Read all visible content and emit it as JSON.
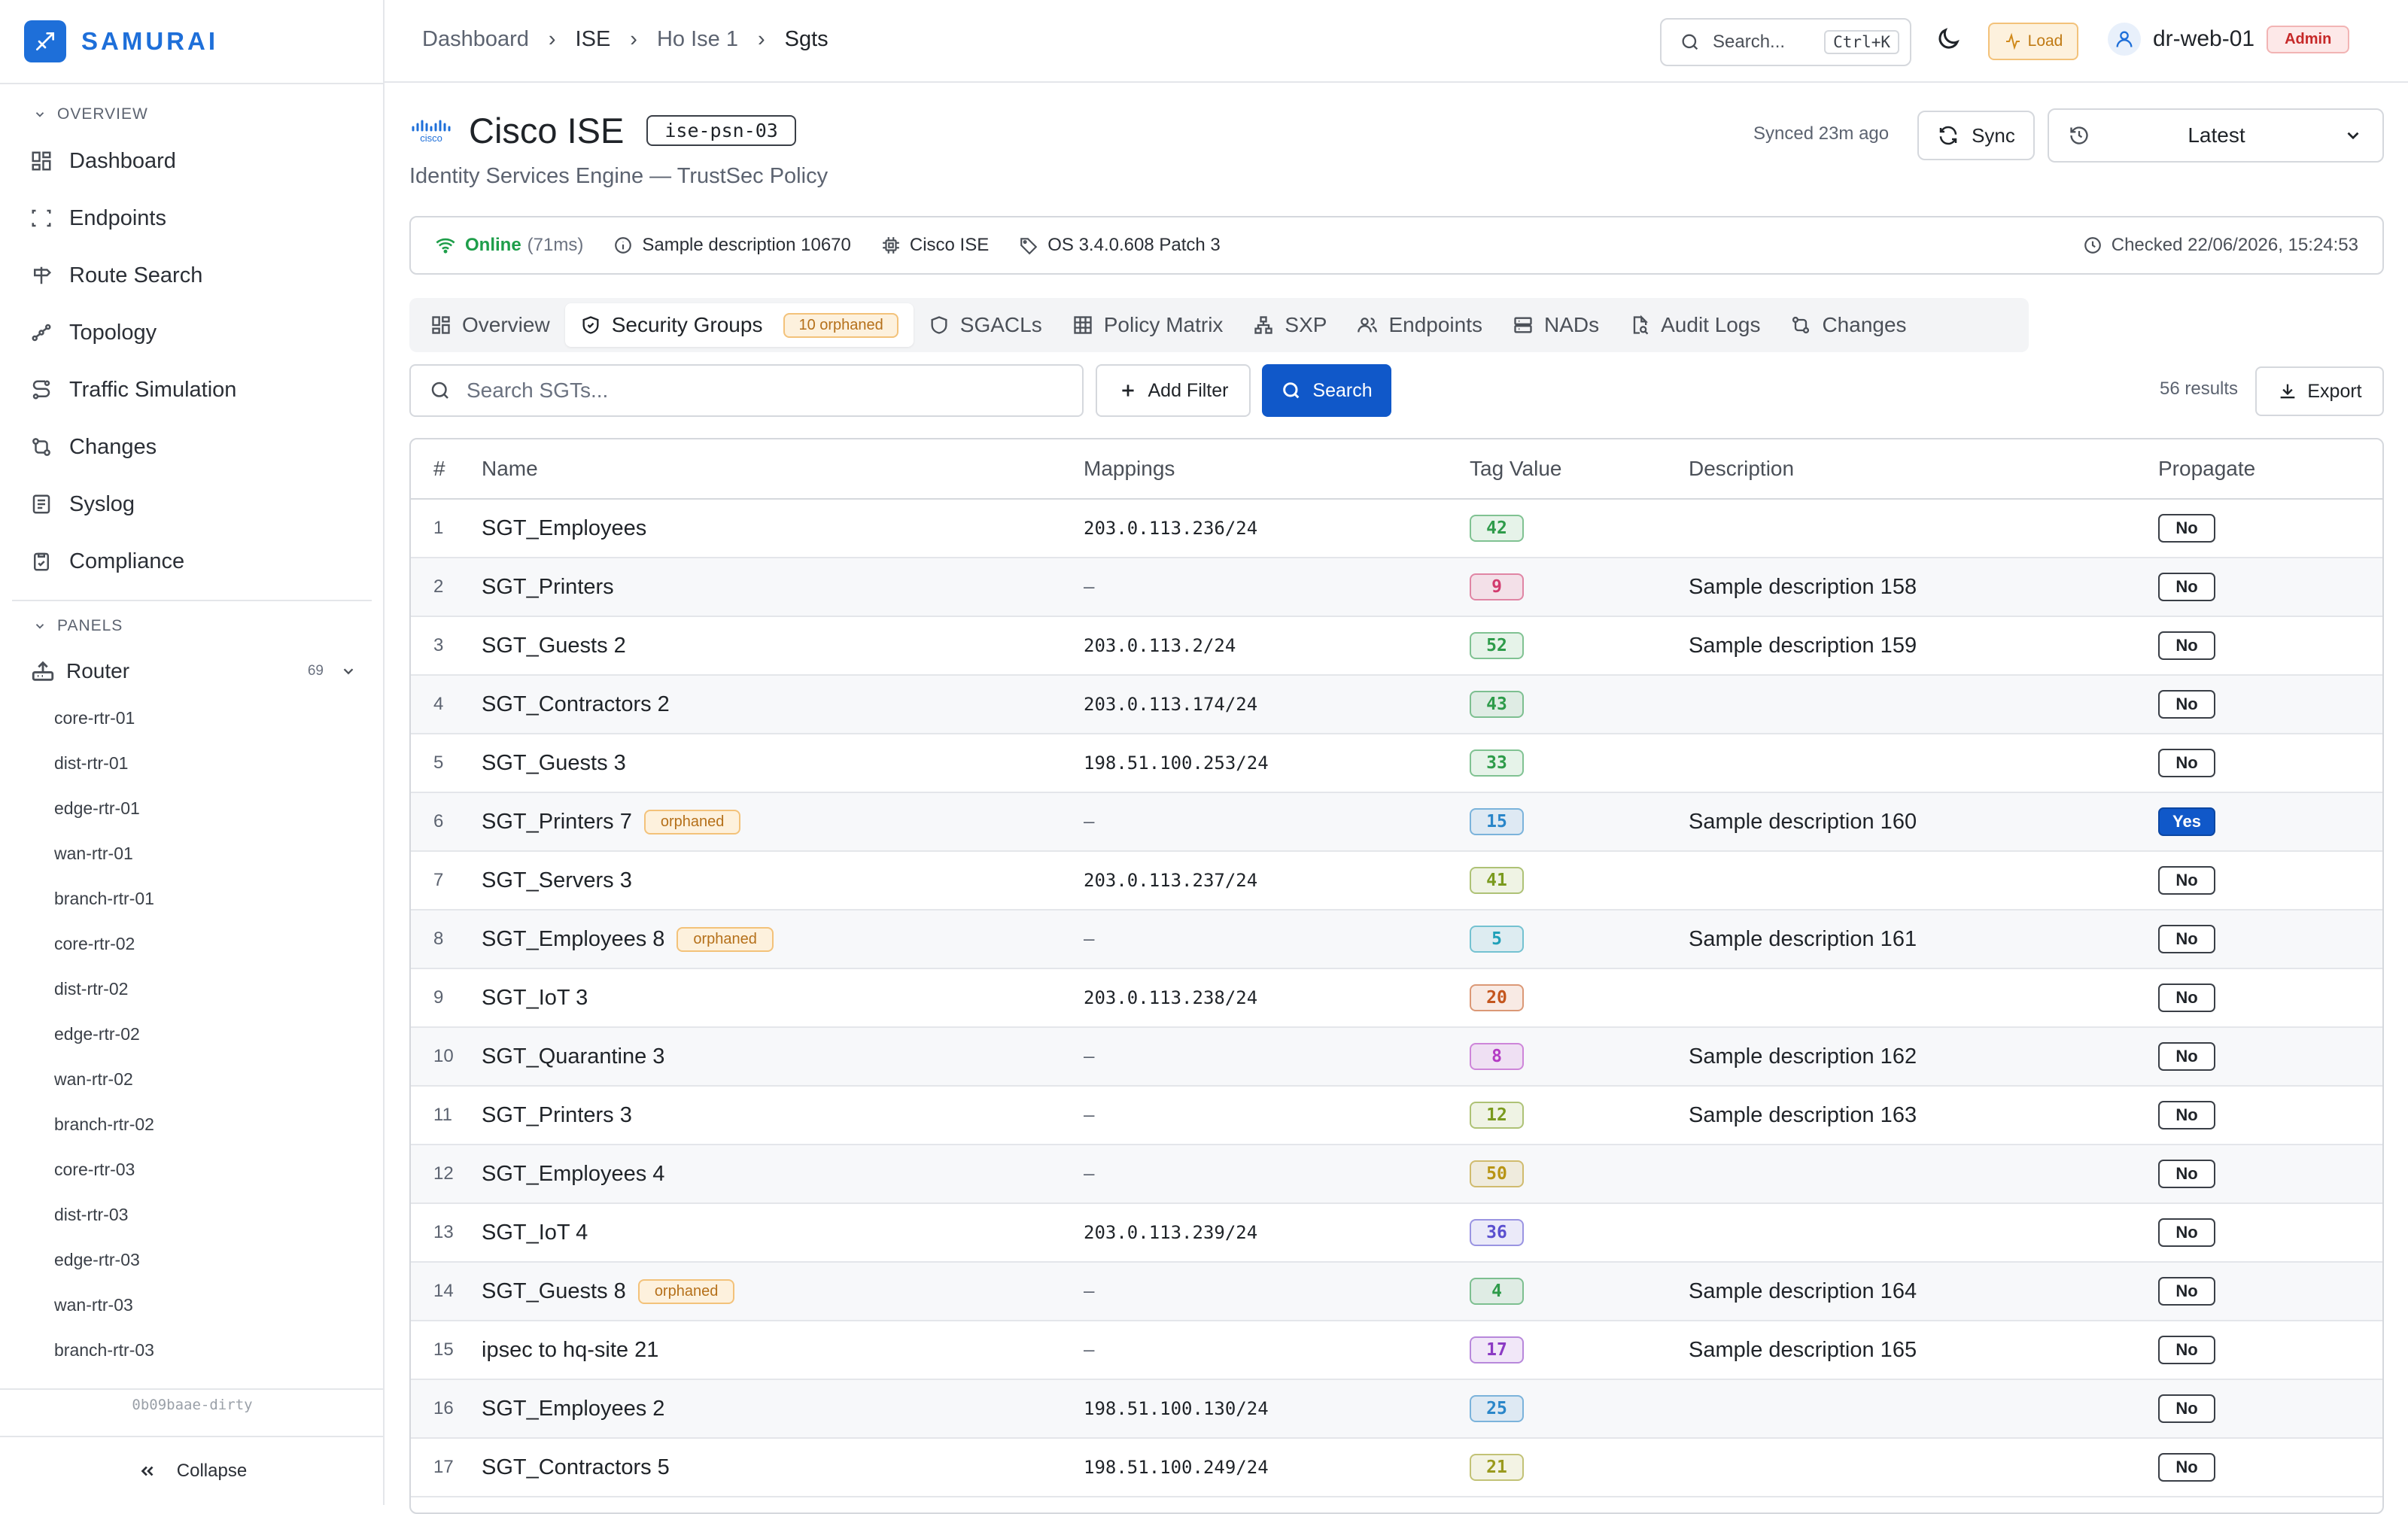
{
  "app": {
    "brand": "SAMURAI",
    "commit": "0b09baae-dirty",
    "collapse_label": "Collapse"
  },
  "sidebar": {
    "overview_label": "OVERVIEW",
    "nav": [
      {
        "label": "Dashboard",
        "icon": "grid-icon"
      },
      {
        "label": "Endpoints",
        "icon": "scan-icon"
      },
      {
        "label": "Route Search",
        "icon": "signpost-icon"
      },
      {
        "label": "Topology",
        "icon": "topology-icon"
      },
      {
        "label": "Traffic Simulation",
        "icon": "route-icon"
      },
      {
        "label": "Changes",
        "icon": "diff-icon"
      },
      {
        "label": "Syslog",
        "icon": "log-icon"
      },
      {
        "label": "Compliance",
        "icon": "clipboard-check-icon"
      }
    ],
    "panels_label": "PANELS",
    "panel": {
      "label": "Router",
      "count": "69"
    },
    "devices": [
      "core-rtr-01",
      "dist-rtr-01",
      "edge-rtr-01",
      "wan-rtr-01",
      "branch-rtr-01",
      "core-rtr-02",
      "dist-rtr-02",
      "edge-rtr-02",
      "wan-rtr-02",
      "branch-rtr-02",
      "core-rtr-03",
      "dist-rtr-03",
      "edge-rtr-03",
      "wan-rtr-03",
      "branch-rtr-03"
    ]
  },
  "header": {
    "breadcrumb": [
      "Dashboard",
      "ISE",
      "Ho Ise 1",
      "Sgts"
    ],
    "search_placeholder": "Search...",
    "search_shortcut": "Ctrl+K",
    "load_label": "Load",
    "user": "dr-web-01",
    "role": "Admin"
  },
  "device": {
    "title": "Cisco ISE",
    "tag": "ise-psn-03",
    "subtitle": "Identity Services Engine — TrustSec Policy",
    "synced": "Synced 23m ago",
    "sync_label": "Sync",
    "version": "Latest",
    "status": "Online",
    "latency": "(71ms)",
    "description": "Sample description 10670",
    "platform": "Cisco ISE",
    "os": "OS 3.4.0.608 Patch 3",
    "checked": "Checked 22/06/2026, 15:24:53"
  },
  "tabs": [
    {
      "label": "Overview",
      "icon": "grid-icon"
    },
    {
      "label": "Security Groups",
      "icon": "shield-check-icon",
      "badge": "10 orphaned",
      "active": true
    },
    {
      "label": "SGACLs",
      "icon": "shield-icon"
    },
    {
      "label": "Policy Matrix",
      "icon": "table-icon"
    },
    {
      "label": "SXP",
      "icon": "network-icon"
    },
    {
      "label": "Endpoints",
      "icon": "users-icon"
    },
    {
      "label": "NADs",
      "icon": "server-icon"
    },
    {
      "label": "Audit Logs",
      "icon": "file-search-icon"
    },
    {
      "label": "Changes",
      "icon": "diff-icon"
    }
  ],
  "toolbar": {
    "search_placeholder": "Search SGTs...",
    "add_filter": "Add Filter",
    "search": "Search",
    "results": "56 results",
    "export": "Export"
  },
  "table": {
    "columns": [
      "#",
      "Name",
      "Mappings",
      "Tag Value",
      "Description",
      "Propagate"
    ],
    "rows": [
      {
        "n": "1",
        "name": "SGT_Employees",
        "orphan": "",
        "map": "203.0.113.236/24",
        "tag": "42",
        "color": "#2e9b4a",
        "desc": "",
        "prop": "No"
      },
      {
        "n": "2",
        "name": "SGT_Printers",
        "orphan": "",
        "map": "—",
        "tag": "9",
        "color": "#d23a6e",
        "desc": "Sample description 158",
        "prop": "No"
      },
      {
        "n": "3",
        "name": "SGT_Guests 2",
        "orphan": "",
        "map": "203.0.113.2/24",
        "tag": "52",
        "color": "#2e9b4a",
        "desc": "Sample description 159",
        "prop": "No"
      },
      {
        "n": "4",
        "name": "SGT_Contractors 2",
        "orphan": "",
        "map": "203.0.113.174/24",
        "tag": "43",
        "color": "#2e9b4a",
        "desc": "",
        "prop": "No"
      },
      {
        "n": "5",
        "name": "SGT_Guests 3",
        "orphan": "",
        "map": "198.51.100.253/24",
        "tag": "33",
        "color": "#2e9b4a",
        "desc": "",
        "prop": "No"
      },
      {
        "n": "6",
        "name": "SGT_Printers 7",
        "orphan": "orphaned",
        "map": "—",
        "tag": "15",
        "color": "#2a86c9",
        "desc": "Sample description 160",
        "prop": "Yes"
      },
      {
        "n": "7",
        "name": "SGT_Servers 3",
        "orphan": "",
        "map": "203.0.113.237/24",
        "tag": "41",
        "color": "#7a9a1e",
        "desc": "",
        "prop": "No"
      },
      {
        "n": "8",
        "name": "SGT_Employees 8",
        "orphan": "orphaned",
        "map": "—",
        "tag": "5",
        "color": "#1fa0b8",
        "desc": "Sample description 161",
        "prop": "No"
      },
      {
        "n": "9",
        "name": "SGT_IoT 3",
        "orphan": "",
        "map": "203.0.113.238/24",
        "tag": "20",
        "color": "#c4561e",
        "desc": "",
        "prop": "No"
      },
      {
        "n": "10",
        "name": "SGT_Quarantine 3",
        "orphan": "",
        "map": "—",
        "tag": "8",
        "color": "#b43ac4",
        "desc": "Sample description 162",
        "prop": "No"
      },
      {
        "n": "11",
        "name": "SGT_Printers 3",
        "orphan": "",
        "map": "—",
        "tag": "12",
        "color": "#7a9a1e",
        "desc": "Sample description 163",
        "prop": "No"
      },
      {
        "n": "12",
        "name": "SGT_Employees 4",
        "orphan": "",
        "map": "—",
        "tag": "50",
        "color": "#b89414",
        "desc": "",
        "prop": "No"
      },
      {
        "n": "13",
        "name": "SGT_IoT 4",
        "orphan": "",
        "map": "203.0.113.239/24",
        "tag": "36",
        "color": "#5a4fcf",
        "desc": "",
        "prop": "No"
      },
      {
        "n": "14",
        "name": "SGT_Guests 8",
        "orphan": "orphaned",
        "map": "—",
        "tag": "4",
        "color": "#2e9b4a",
        "desc": "Sample description 164",
        "prop": "No"
      },
      {
        "n": "15",
        "name": "ipsec to hq-site 21",
        "orphan": "",
        "map": "—",
        "tag": "17",
        "color": "#8b3ac4",
        "desc": "Sample description 165",
        "prop": "No"
      },
      {
        "n": "16",
        "name": "SGT_Employees 2",
        "orphan": "",
        "map": "198.51.100.130/24",
        "tag": "25",
        "color": "#2a86c9",
        "desc": "",
        "prop": "No"
      },
      {
        "n": "17",
        "name": "SGT_Contractors 5",
        "orphan": "",
        "map": "198.51.100.249/24",
        "tag": "21",
        "color": "#9a9a1e",
        "desc": "",
        "prop": "No"
      }
    ]
  }
}
